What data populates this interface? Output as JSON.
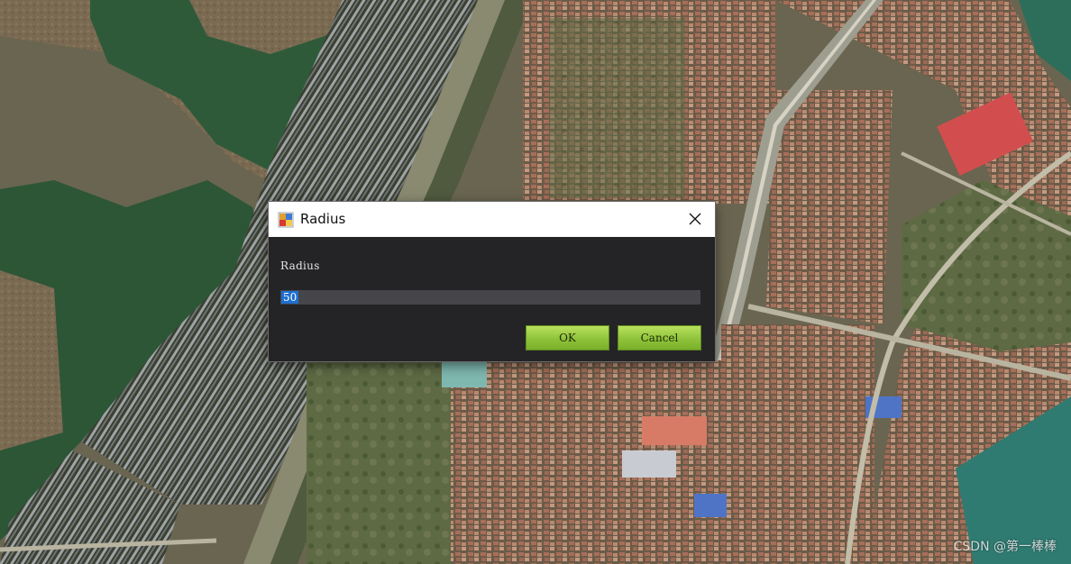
{
  "dialog": {
    "title": "Radius",
    "field_label": "Radius",
    "input_value": "50",
    "ok_label": "OK",
    "cancel_label": "Cancel",
    "close_icon": "close-icon",
    "app_icon": "app-icon"
  },
  "background": {
    "description_icon": "satellite-map-image"
  },
  "watermark": "CSDN @第一棒棒"
}
